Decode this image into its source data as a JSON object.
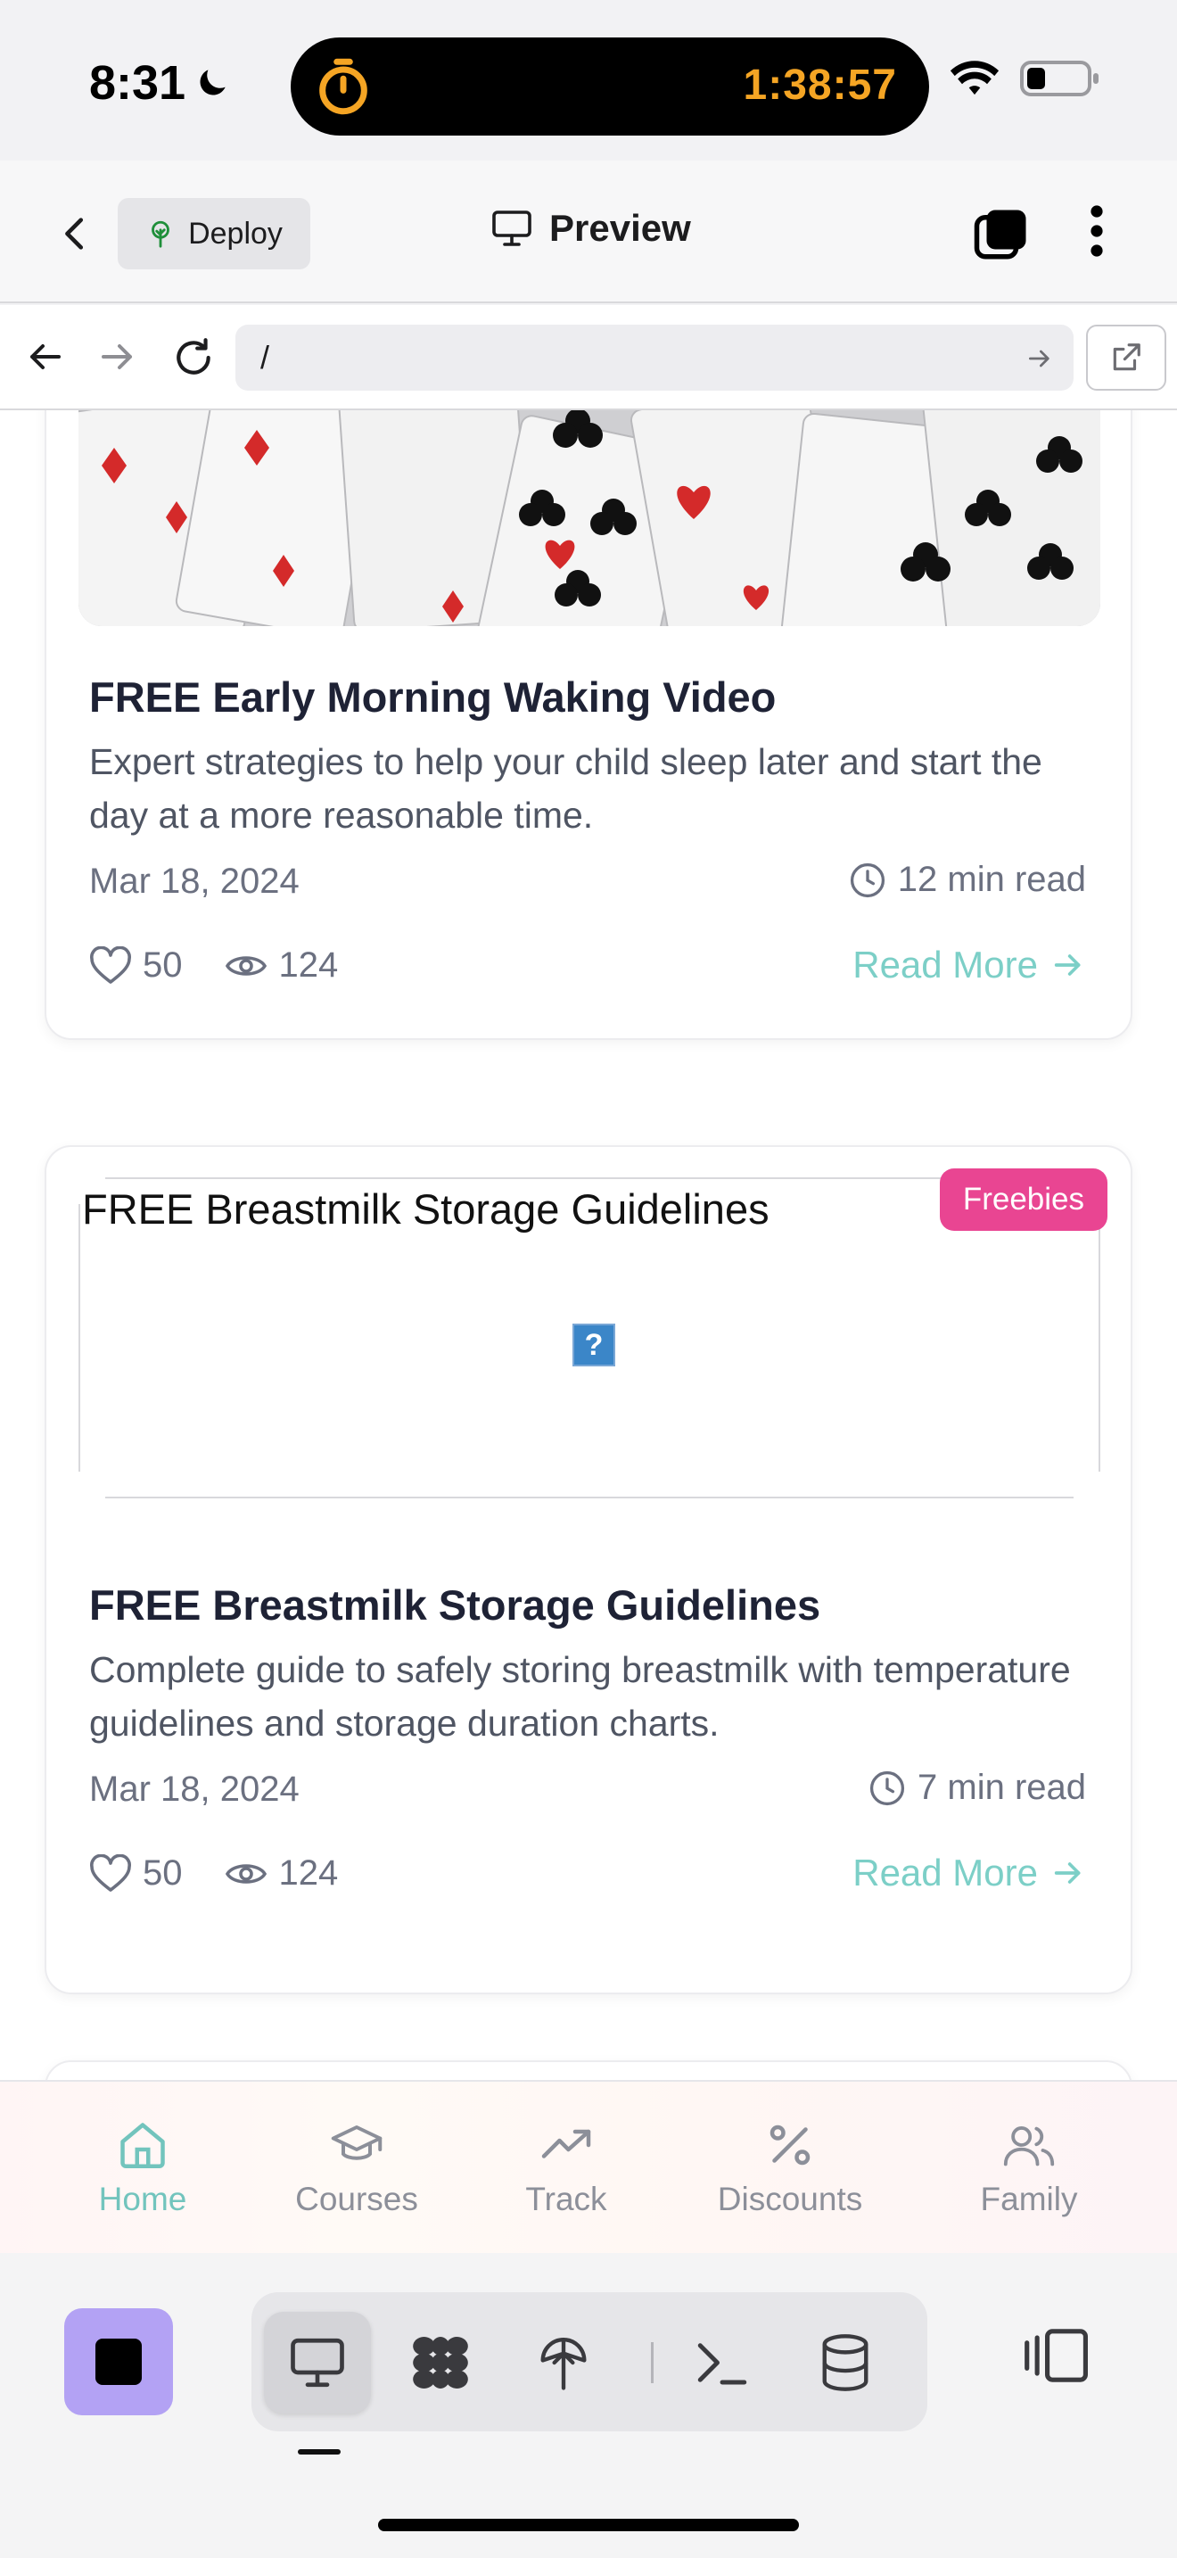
{
  "status_bar": {
    "time": "8:31",
    "timer": "1:38:57"
  },
  "header": {
    "deploy_label": "Deploy",
    "title": "Preview"
  },
  "url_bar": {
    "path": "/"
  },
  "cards": [
    {
      "title": "FREE Early Morning Waking Video",
      "description": "Expert strategies to help your child sleep later and start the day at a more reasonable time.",
      "date": "Mar 18, 2024",
      "read_time": "12 min read",
      "likes": "50",
      "views": "124",
      "read_more": "Read More"
    },
    {
      "image_alt": "FREE Breastmilk Storage Guidelines",
      "badge": "Freebies",
      "title": "FREE Breastmilk Storage Guidelines",
      "description": "Complete guide to safely storing breastmilk with temperature guidelines and storage duration charts.",
      "date": "Mar 18, 2024",
      "read_time": "7 min read",
      "likes": "50",
      "views": "124",
      "read_more": "Read More"
    }
  ],
  "broken_image_glyph": "?",
  "bottom_nav": [
    {
      "label": "Home",
      "icon": "home-icon",
      "active": true
    },
    {
      "label": "Courses",
      "icon": "graduation-cap-icon",
      "active": false
    },
    {
      "label": "Track",
      "icon": "trending-up-icon",
      "active": false
    },
    {
      "label": "Discounts",
      "icon": "percent-icon",
      "active": false
    },
    {
      "label": "Family",
      "icon": "users-icon",
      "active": false
    }
  ],
  "colors": {
    "accent_teal": "#72c4bd",
    "badge_pink": "#e94592",
    "stop_purple": "#b3a2f4",
    "timer_orange": "#f5a524"
  }
}
